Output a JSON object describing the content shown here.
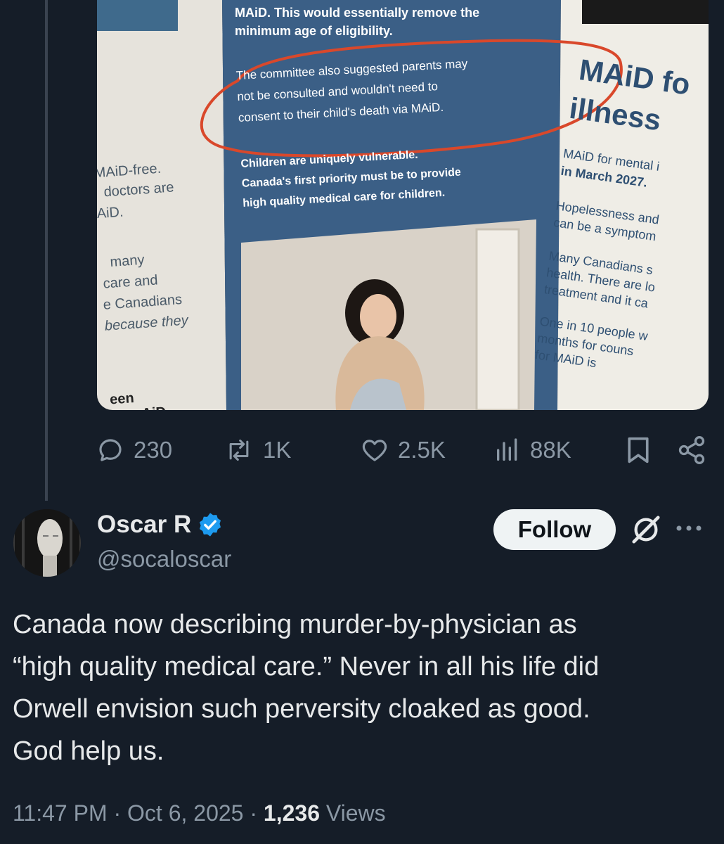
{
  "image": {
    "caption_top_1": "MAiD. This would essentially remove the",
    "caption_top_2": "minimum age of eligibility.",
    "para_1": "The committee also suggested parents may",
    "para_2": "not be consulted and wouldn't need to",
    "para_3": "consent to their child's death via MAiD.",
    "bold_1": "Children are uniquely vulnerable.",
    "bold_2": "Canada's first priority must be to provide",
    "bold_3": "high quality medical care for children.",
    "left_1": "MAiD-free.",
    "left_2": "doctors are",
    "left_3": "AiD.",
    "left_4": "many",
    "left_5": "care and",
    "left_6": "e Canadians",
    "left_7": "because they",
    "left_8": "een",
    "left_9": "AiD.",
    "right_title_1": "MAiD fo",
    "right_title_2": "illness",
    "right_1": "MAiD for mental i",
    "right_2": "in March 2027.",
    "right_3": "Hopelessness and",
    "right_4": "can be a symptom",
    "right_5": "Many Canadians s",
    "right_6": "health. There are lo",
    "right_7": "treatment and it ca",
    "right_8": "One in 10 people w",
    "right_9": "months for couns",
    "right_10": "for MAiD is"
  },
  "actions": {
    "replies": "230",
    "reposts": "1K",
    "likes": "2.5K",
    "views": "88K"
  },
  "author": {
    "name": "Oscar R",
    "handle": "@socaloscar",
    "follow_label": "Follow"
  },
  "tweet": {
    "text": "Canada now describing murder-by-physician as\n“high quality medical care.” Never in all his life did\nOrwell envision such perversity cloaked as good.\nGod help us."
  },
  "meta": {
    "time": "11:47 PM",
    "date": "Oct 6, 2025",
    "views_count": "1,236",
    "views_label": "Views"
  },
  "colors": {
    "background": "#151d28",
    "brochure_blue": "#3b5f86",
    "verified_blue": "#1d9bf0",
    "muted_text": "#8b98a5"
  }
}
